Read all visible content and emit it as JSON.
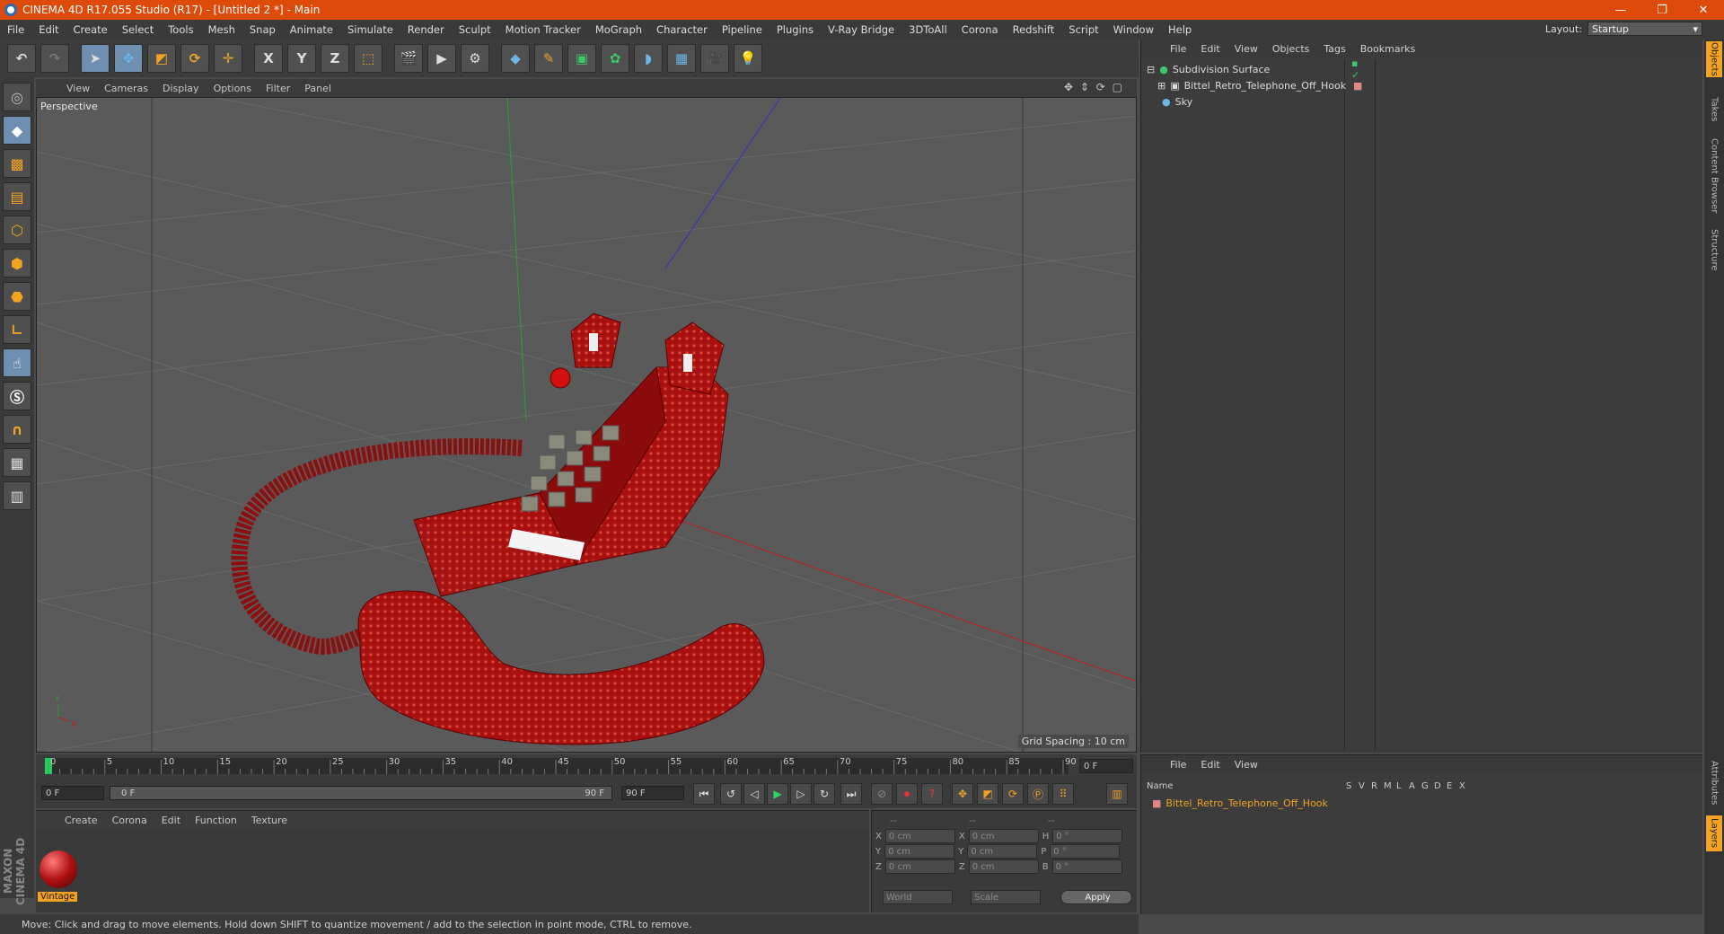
{
  "window": {
    "title": "CINEMA 4D R17.055 Studio (R17) - [Untitled 2 *] - Main",
    "controls": [
      "—",
      "❐",
      "✕"
    ]
  },
  "menu": [
    "File",
    "Edit",
    "Create",
    "Select",
    "Tools",
    "Mesh",
    "Snap",
    "Animate",
    "Simulate",
    "Render",
    "Sculpt",
    "Motion Tracker",
    "MoGraph",
    "Character",
    "Pipeline",
    "Plugins",
    "V-Ray Bridge",
    "3DToAll",
    "Corona",
    "Redshift",
    "Script",
    "Window",
    "Help"
  ],
  "layout": {
    "label": "Layout:",
    "value": "Startup"
  },
  "toolbar": {
    "axis_x": "X",
    "axis_y": "Y",
    "axis_z": "Z"
  },
  "viewport": {
    "menu": [
      "View",
      "Cameras",
      "Display",
      "Options",
      "Filter",
      "Panel"
    ],
    "label": "Perspective",
    "grid_spacing": "Grid Spacing : 10 cm"
  },
  "timeline": {
    "ticks": [
      "0",
      "5",
      "10",
      "15",
      "20",
      "25",
      "30",
      "35",
      "40",
      "45",
      "50",
      "55",
      "60",
      "65",
      "70",
      "75",
      "80",
      "85",
      "90"
    ],
    "current": "0 F"
  },
  "transport": {
    "start": "0 F",
    "range_start": "0 F",
    "range_end": "90 F",
    "end": "90 F"
  },
  "material_panel": {
    "menu": [
      "Create",
      "Corona",
      "Edit",
      "Function",
      "Texture"
    ],
    "material_name": "Vintage"
  },
  "coords": {
    "header": [
      "--",
      "--",
      "--"
    ],
    "rows": [
      {
        "a": "X",
        "v1": "0 cm",
        "b": "X",
        "v2": "0 cm",
        "c": "H",
        "v3": "0 °"
      },
      {
        "a": "Y",
        "v1": "0 cm",
        "b": "Y",
        "v2": "0 cm",
        "c": "P",
        "v3": "0 °"
      },
      {
        "a": "Z",
        "v1": "0 cm",
        "b": "Z",
        "v2": "0 cm",
        "c": "B",
        "v3": "0 °"
      }
    ],
    "world": "World",
    "scale": "Scale",
    "apply": "Apply"
  },
  "object_manager": {
    "menu": [
      "File",
      "Edit",
      "View",
      "Objects",
      "Tags",
      "Bookmarks"
    ],
    "objects": [
      "Subdivision Surface",
      "Bittel_Retro_Telephone_Off_Hook",
      "Sky"
    ]
  },
  "layer_manager": {
    "menu": [
      "File",
      "Edit",
      "View"
    ],
    "columns": [
      "Name",
      "S",
      "V",
      "R",
      "M",
      "L",
      "A",
      "G",
      "D",
      "E",
      "X"
    ],
    "layer": "Bittel_Retro_Telephone_Off_Hook"
  },
  "right_tabs": [
    "Objects",
    "Takes",
    "Content Browser",
    "Structure",
    "Attributes",
    "Layers"
  ],
  "status": "Move: Click and drag to move elements. Hold down SHIFT to quantize movement / add to the selection in point mode, CTRL to remove.",
  "maxon": "MAXON CINEMA 4D",
  "colors": {
    "title": "#dd4a0a",
    "accent": "#f3a324",
    "phone": "#a80f0f"
  }
}
